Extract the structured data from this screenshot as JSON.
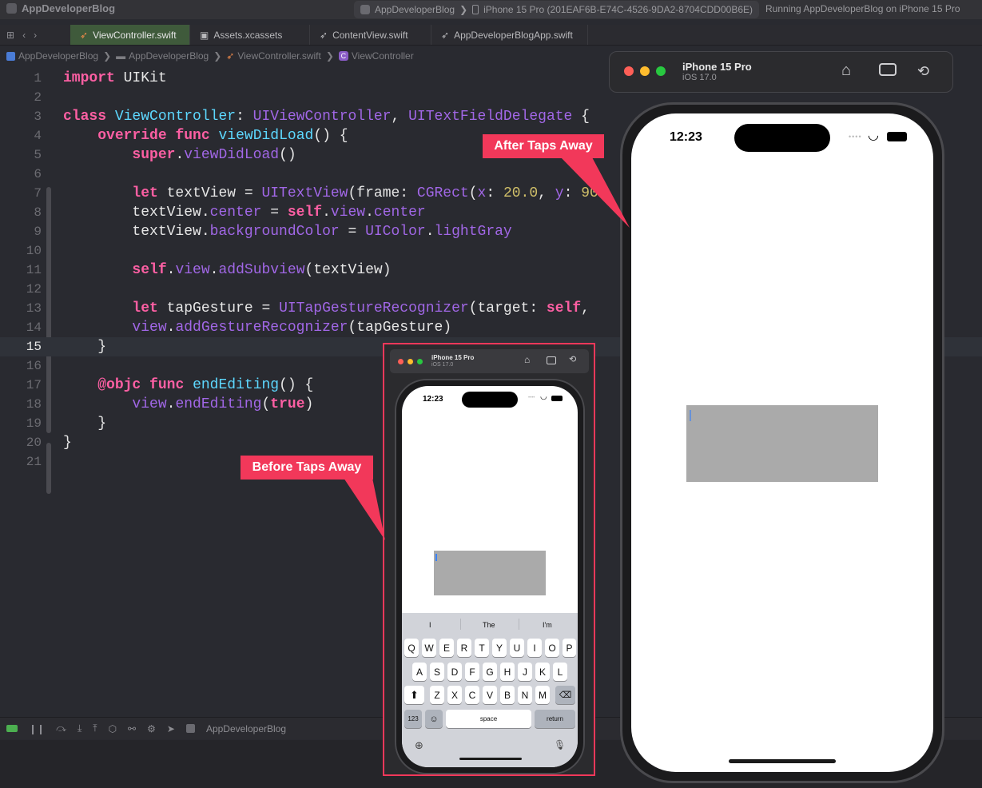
{
  "titlebar": {
    "app_name": "AppDeveloperBlog",
    "scheme": "AppDeveloperBlog",
    "destination": "iPhone 15 Pro (201EAF6B-E74C-4526-9DA2-8704CDD00B6E)",
    "status": "Running AppDeveloperBlog on iPhone 15 Pro"
  },
  "tabs": [
    {
      "label": "ViewController.swift",
      "icon": "swift-icon"
    },
    {
      "label": "Assets.xcassets",
      "icon": "assets-icon"
    },
    {
      "label": "ContentView.swift",
      "icon": "swift-icon"
    },
    {
      "label": "AppDeveloperBlogApp.swift",
      "icon": "swift-icon"
    }
  ],
  "breadcrumb": [
    "AppDeveloperBlog",
    "AppDeveloperBlog",
    "ViewController.swift",
    "ViewController"
  ],
  "editor": {
    "current_line": 15
  },
  "debugbar": {
    "target": "AppDeveloperBlog"
  },
  "simulator_after": {
    "device": "iPhone 15 Pro",
    "os": "iOS 17.0",
    "time": "12:23"
  },
  "simulator_before": {
    "device": "iPhone 15 Pro",
    "os": "iOS 17.0",
    "time": "12:23"
  },
  "keyboard": {
    "suggestions": [
      "I",
      "The",
      "I'm"
    ],
    "row1": [
      "Q",
      "W",
      "E",
      "R",
      "T",
      "Y",
      "U",
      "I",
      "O",
      "P"
    ],
    "row2": [
      "A",
      "S",
      "D",
      "F",
      "G",
      "H",
      "J",
      "K",
      "L"
    ],
    "row3": [
      "Z",
      "X",
      "C",
      "V",
      "B",
      "N",
      "M"
    ],
    "numbers_key": "123",
    "space_key": "space",
    "return_key": "return"
  },
  "annotations": {
    "after": "After Taps Away",
    "before": "Before Taps Away"
  },
  "colors": {
    "callout": "#f2385a",
    "active_tab": "#3f5a3b",
    "textview_bg": "#aaaaaa"
  }
}
